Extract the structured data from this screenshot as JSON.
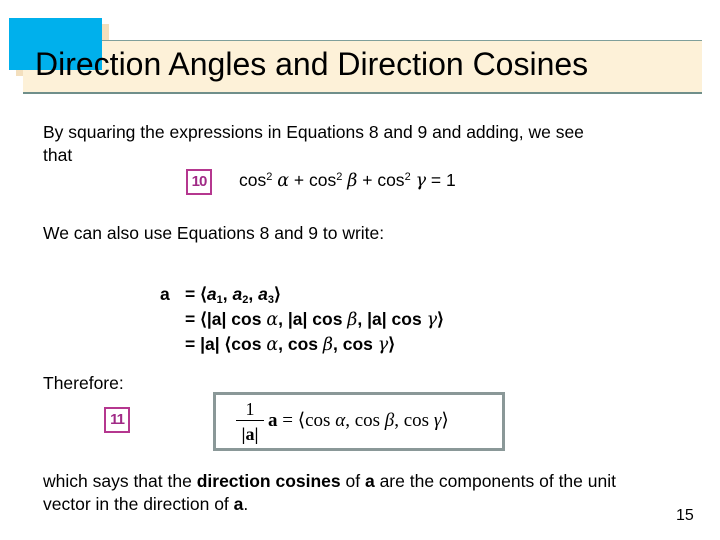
{
  "slide": {
    "title": "Direction Angles and Direction Cosines",
    "colors": {
      "accent_blue": "#00b0ec",
      "title_bar_beige": "#fdf1d8",
      "shadow_tan": "#f3dfbd",
      "equation_badge_magenta": "#b5378f",
      "box_border_grey": "#8a9898"
    },
    "intro_line1": "By squaring the expressions in Equations 8 and 9 and adding, we see",
    "intro_line2": "that",
    "equation10": {
      "badge": "10",
      "cos_sq_1": "cos",
      "exp1": "2",
      "alpha": "α",
      "plus1": " + cos",
      "exp2": "2",
      "beta": "β",
      "plus2": " + cos",
      "exp3": "2",
      "gamma": "γ",
      "equals_one": " = 1"
    },
    "also_text": "We can also use Equations 8 and 9 to write:",
    "derivation": {
      "lhs": "a",
      "row1": {
        "eq": "= ⟨",
        "a1": "a",
        "s1": "1",
        "c1": ", ",
        "a2": "a",
        "s2": "2",
        "c2": ", ",
        "a3": "a",
        "s3": "3",
        "close": "⟩"
      },
      "row2": {
        "pre": "= ⟨|a| cos ",
        "alpha": "α",
        "mid1": ", |a| cos ",
        "beta": "β",
        "mid2": ", |a| cos ",
        "gamma": "γ",
        "close": "⟩"
      },
      "row3": {
        "pre": "= |a| ⟨cos ",
        "alpha": "α",
        "mid1": ", cos ",
        "beta": "β",
        "mid2": ", cos ",
        "gamma": "γ",
        "close": "⟩"
      }
    },
    "therefore_text": "Therefore:",
    "equation11": {
      "badge": "11",
      "numerator": "1",
      "denominator": "|a|",
      "vector": "a",
      "rhs_pre": " = ⟨cos ",
      "alpha": "α",
      "mid1": ", cos ",
      "beta": "β",
      "mid2": ", cos ",
      "gamma": "γ",
      "close": "⟩"
    },
    "conclusion": {
      "part1": "which says that the ",
      "bold_term": "direction cosines",
      "part2": " of ",
      "bold_a1": "a",
      "part3": " are the components of the unit",
      "line2_part1": "vector in the direction of ",
      "bold_a2": "a",
      "line2_end": "."
    },
    "page_number": "15"
  }
}
